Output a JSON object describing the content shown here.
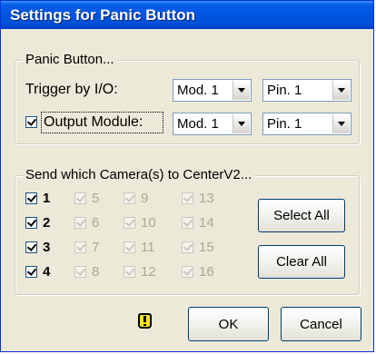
{
  "window": {
    "title": "Settings for Panic Button"
  },
  "panic_group": {
    "legend": "Panic Button...",
    "trigger_label": "Trigger by I/O:",
    "trigger_module": "Mod. 1",
    "trigger_pin": "Pin. 1",
    "output_label": "Output Module:",
    "output_checked": true,
    "output_module": "Mod. 1",
    "output_pin": "Pin. 1"
  },
  "camera_group": {
    "legend": "Send which Camera(s) to CenterV2...",
    "cameras": [
      {
        "label": "1",
        "checked": true,
        "enabled": true
      },
      {
        "label": "2",
        "checked": true,
        "enabled": true
      },
      {
        "label": "3",
        "checked": true,
        "enabled": true
      },
      {
        "label": "4",
        "checked": true,
        "enabled": true
      },
      {
        "label": "5",
        "checked": true,
        "enabled": false
      },
      {
        "label": "6",
        "checked": true,
        "enabled": false
      },
      {
        "label": "7",
        "checked": true,
        "enabled": false
      },
      {
        "label": "8",
        "checked": true,
        "enabled": false
      },
      {
        "label": "9",
        "checked": true,
        "enabled": false
      },
      {
        "label": "10",
        "checked": true,
        "enabled": false
      },
      {
        "label": "11",
        "checked": true,
        "enabled": false
      },
      {
        "label": "12",
        "checked": true,
        "enabled": false
      },
      {
        "label": "13",
        "checked": true,
        "enabled": false
      },
      {
        "label": "14",
        "checked": true,
        "enabled": false
      },
      {
        "label": "15",
        "checked": true,
        "enabled": false
      },
      {
        "label": "16",
        "checked": true,
        "enabled": false
      }
    ],
    "select_all_label": "Select All",
    "clear_all_label": "Clear All"
  },
  "footer": {
    "icon": "warning-icon",
    "ok_label": "OK",
    "cancel_label": "Cancel"
  },
  "colors": {
    "titlebar": "#0054e3",
    "dialog_bg": "#ece9d8",
    "disabled_text": "#aca899"
  }
}
